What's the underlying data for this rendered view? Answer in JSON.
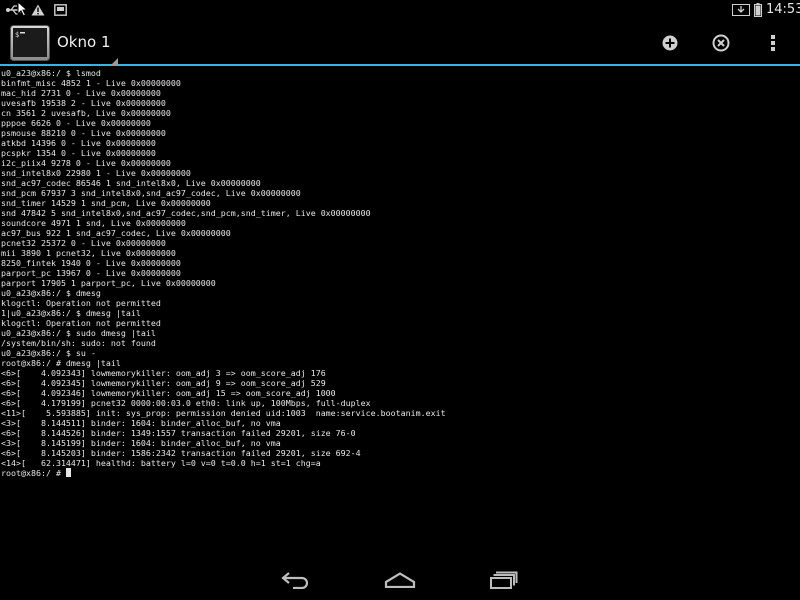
{
  "status_bar": {
    "time": "14:53",
    "icons": [
      "usb-debug-icon",
      "warning-icon",
      "screenshot-icon",
      "download-icon",
      "battery-icon"
    ]
  },
  "action_bar": {
    "window_title": "Okno 1",
    "actions": [
      "new-window",
      "close-window",
      "overflow-menu"
    ]
  },
  "terminal": {
    "lines": [
      "u0_a23@x86:/ $ lsmod",
      "binfmt_misc 4852 1 - Live 0x00000000",
      "mac_hid 2731 0 - Live 0x00000000",
      "uvesafb 19538 2 - Live 0x00000000",
      "cn 3561 2 uvesafb, Live 0x00000000",
      "pppoe 6626 0 - Live 0x00000000",
      "psmouse 88210 0 - Live 0x00000000",
      "atkbd 14396 0 - Live 0x00000000",
      "pcspkr 1354 0 - Live 0x00000000",
      "i2c_piix4 9278 0 - Live 0x00000000",
      "snd_intel8x0 22980 1 - Live 0x00000000",
      "snd_ac97_codec 86546 1 snd_intel8x0, Live 0x00000000",
      "snd_pcm 67937 3 snd_intel8x0,snd_ac97_codec, Live 0x00000000",
      "snd_timer 14529 1 snd_pcm, Live 0x00000000",
      "snd 47842 5 snd_intel8x0,snd_ac97_codec,snd_pcm,snd_timer, Live 0x00000000",
      "soundcore 4971 1 snd, Live 0x00000000",
      "ac97_bus 922 1 snd_ac97_codec, Live 0x00000000",
      "pcnet32 25372 0 - Live 0x00000000",
      "mii 3890 1 pcnet32, Live 0x00000000",
      "8250_fintek 1940 0 - Live 0x00000000",
      "parport_pc 13967 0 - Live 0x00000000",
      "parport 17905 1 parport_pc, Live 0x00000000",
      "u0_a23@x86:/ $ dmesg",
      "klogctl: Operation not permitted",
      "1|u0_a23@x86:/ $ dmesg |tail",
      "klogctl: Operation not permitted",
      "u0_a23@x86:/ $ sudo dmesg |tail",
      "/system/bin/sh: sudo: not found",
      "u0_a23@x86:/ $ su -",
      "root@x86:/ # dmesg |tail",
      "<6>[    4.092343] lowmemorykiller: oom_adj 3 => oom_score_adj 176",
      "<6>[    4.092345] lowmemorykiller: oom_adj 9 => oom_score_adj 529",
      "<6>[    4.092346] lowmemorykiller: oom_adj 15 => oom_score_adj 1000",
      "<6>[    4.179199] pcnet32 0000:00:03.0 eth0: link up, 100Mbps, full-duplex",
      "<11>[    5.593885] init: sys_prop: permission denied uid:1003  name:service.bootanim.exit",
      "<3>[    8.144511] binder: 1604: binder_alloc_buf, no vma",
      "<6>[    8.144526] binder: 1349:1557 transaction failed 29201, size 76-0",
      "<3>[    8.145199] binder: 1604: binder_alloc_buf, no vma",
      "<6>[    8.145203] binder: 1586:2342 transaction failed 29201, size 692-4",
      "<14>[   62.314471] healthd: battery l=0 v=0 t=0.0 h=1 st=1 chg=a"
    ],
    "prompt": "root@x86:/ # "
  },
  "nav_bar": {
    "buttons": [
      "back",
      "home",
      "recents"
    ]
  },
  "colors": {
    "accent": "#33b5e5",
    "text": "#e6e6e6",
    "icon": "#cccccc"
  }
}
